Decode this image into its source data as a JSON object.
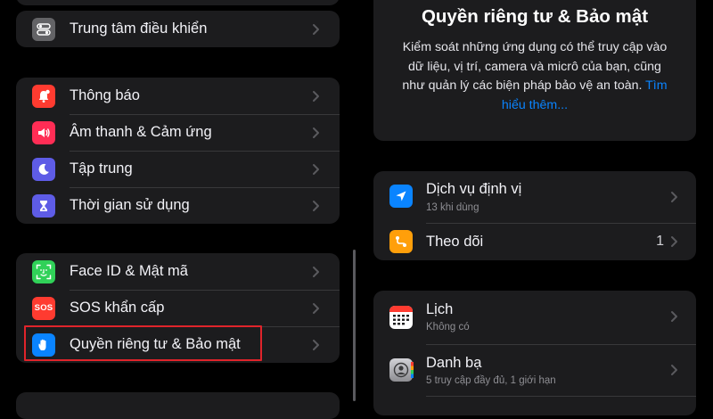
{
  "left": {
    "group1": [
      {
        "label": "Trung tâm điều khiển",
        "icon": "control-center-icon",
        "color": "#636366"
      }
    ],
    "group2": [
      {
        "label": "Thông báo",
        "icon": "bell-icon",
        "color": "#ff3b30"
      },
      {
        "label": "Âm thanh & Cảm ứng",
        "icon": "speaker-icon",
        "color": "#ff2d55"
      },
      {
        "label": "Tập trung",
        "icon": "moon-icon",
        "color": "#5e5ce6"
      },
      {
        "label": "Thời gian sử dụng",
        "icon": "hourglass-icon",
        "color": "#5e5ce6"
      }
    ],
    "group3": [
      {
        "label": "Face ID & Mật mã",
        "icon": "face-id-icon",
        "color": "#30d158"
      },
      {
        "label": "SOS khẩn cấp",
        "icon": "sos-icon",
        "color": "#ff3b30",
        "icon_text": "SOS"
      },
      {
        "label": "Quyền riêng tư & Bảo mật",
        "icon": "hand-icon",
        "color": "#0a84ff"
      }
    ],
    "highlight_color": "#e0242b"
  },
  "right": {
    "header": {
      "title": "Quyền riêng tư & Bảo mật",
      "description": "Kiểm soát những ứng dụng có thể truy cập vào dữ liệu, vị trí, camera và micrô của bạn, cũng như quản lý các biện pháp bảo vệ an toàn.",
      "link": "Tìm hiểu thêm..."
    },
    "group1": {
      "location": {
        "title": "Dịch vụ định vị",
        "subtitle": "13 khi dùng",
        "icon": "location-arrow-icon",
        "color": "#0a84ff"
      },
      "tracking": {
        "title": "Theo dõi",
        "count": "1",
        "icon": "tracking-icon",
        "color": "#ff9f0a"
      }
    },
    "group2": {
      "calendar": {
        "title": "Lịch",
        "subtitle": "Không có",
        "icon": "calendar-icon"
      },
      "contacts": {
        "title": "Danh bạ",
        "subtitle": "5 truy cập đầy đủ, 1 giới hạn",
        "icon": "contacts-icon"
      }
    },
    "accent": "#0a84ff"
  }
}
